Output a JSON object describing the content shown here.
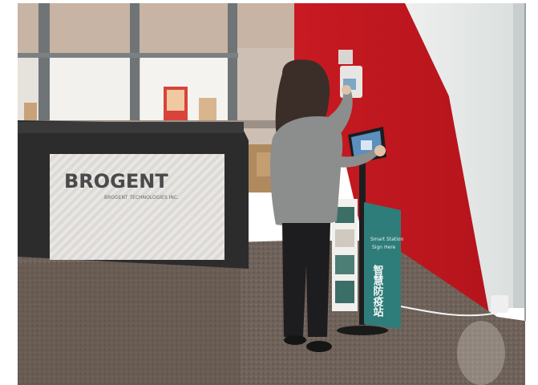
{
  "scene": {
    "description_hidden": "",
    "logo": {
      "text": "BROGENT",
      "subtext": "BROGENT TECHNOLOGIES INC."
    },
    "panel": {
      "headline": "智慧防疫站",
      "small_lines": [
        "Smart Station",
        "Sign Here"
      ]
    }
  }
}
